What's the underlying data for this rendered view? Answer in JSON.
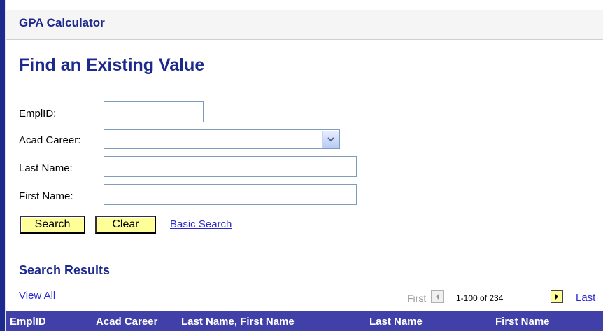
{
  "header": {
    "app_title": "GPA Calculator"
  },
  "page": {
    "title": "Find an Existing Value"
  },
  "form": {
    "emplid": {
      "label": "EmplID:",
      "value": ""
    },
    "acad_career": {
      "label": "Acad Career:",
      "value": ""
    },
    "last_name": {
      "label": "Last Name:",
      "value": ""
    },
    "first_name": {
      "label": "First Name:",
      "value": ""
    }
  },
  "buttons": {
    "search": "Search",
    "clear": "Clear",
    "basic_search": "Basic Search"
  },
  "results": {
    "title": "Search Results",
    "view_all": "View All",
    "nav": {
      "first": "First",
      "range": "1-100 of 234",
      "last": "Last"
    },
    "columns": [
      "EmplID",
      "Acad Career",
      "Last Name, First Name",
      "Last Name",
      "First Name"
    ]
  },
  "colors": {
    "brand": "#1b2a8c",
    "grid_header": "#4040a8",
    "button_bg": "#ffff99",
    "link": "#2a2ad0"
  }
}
